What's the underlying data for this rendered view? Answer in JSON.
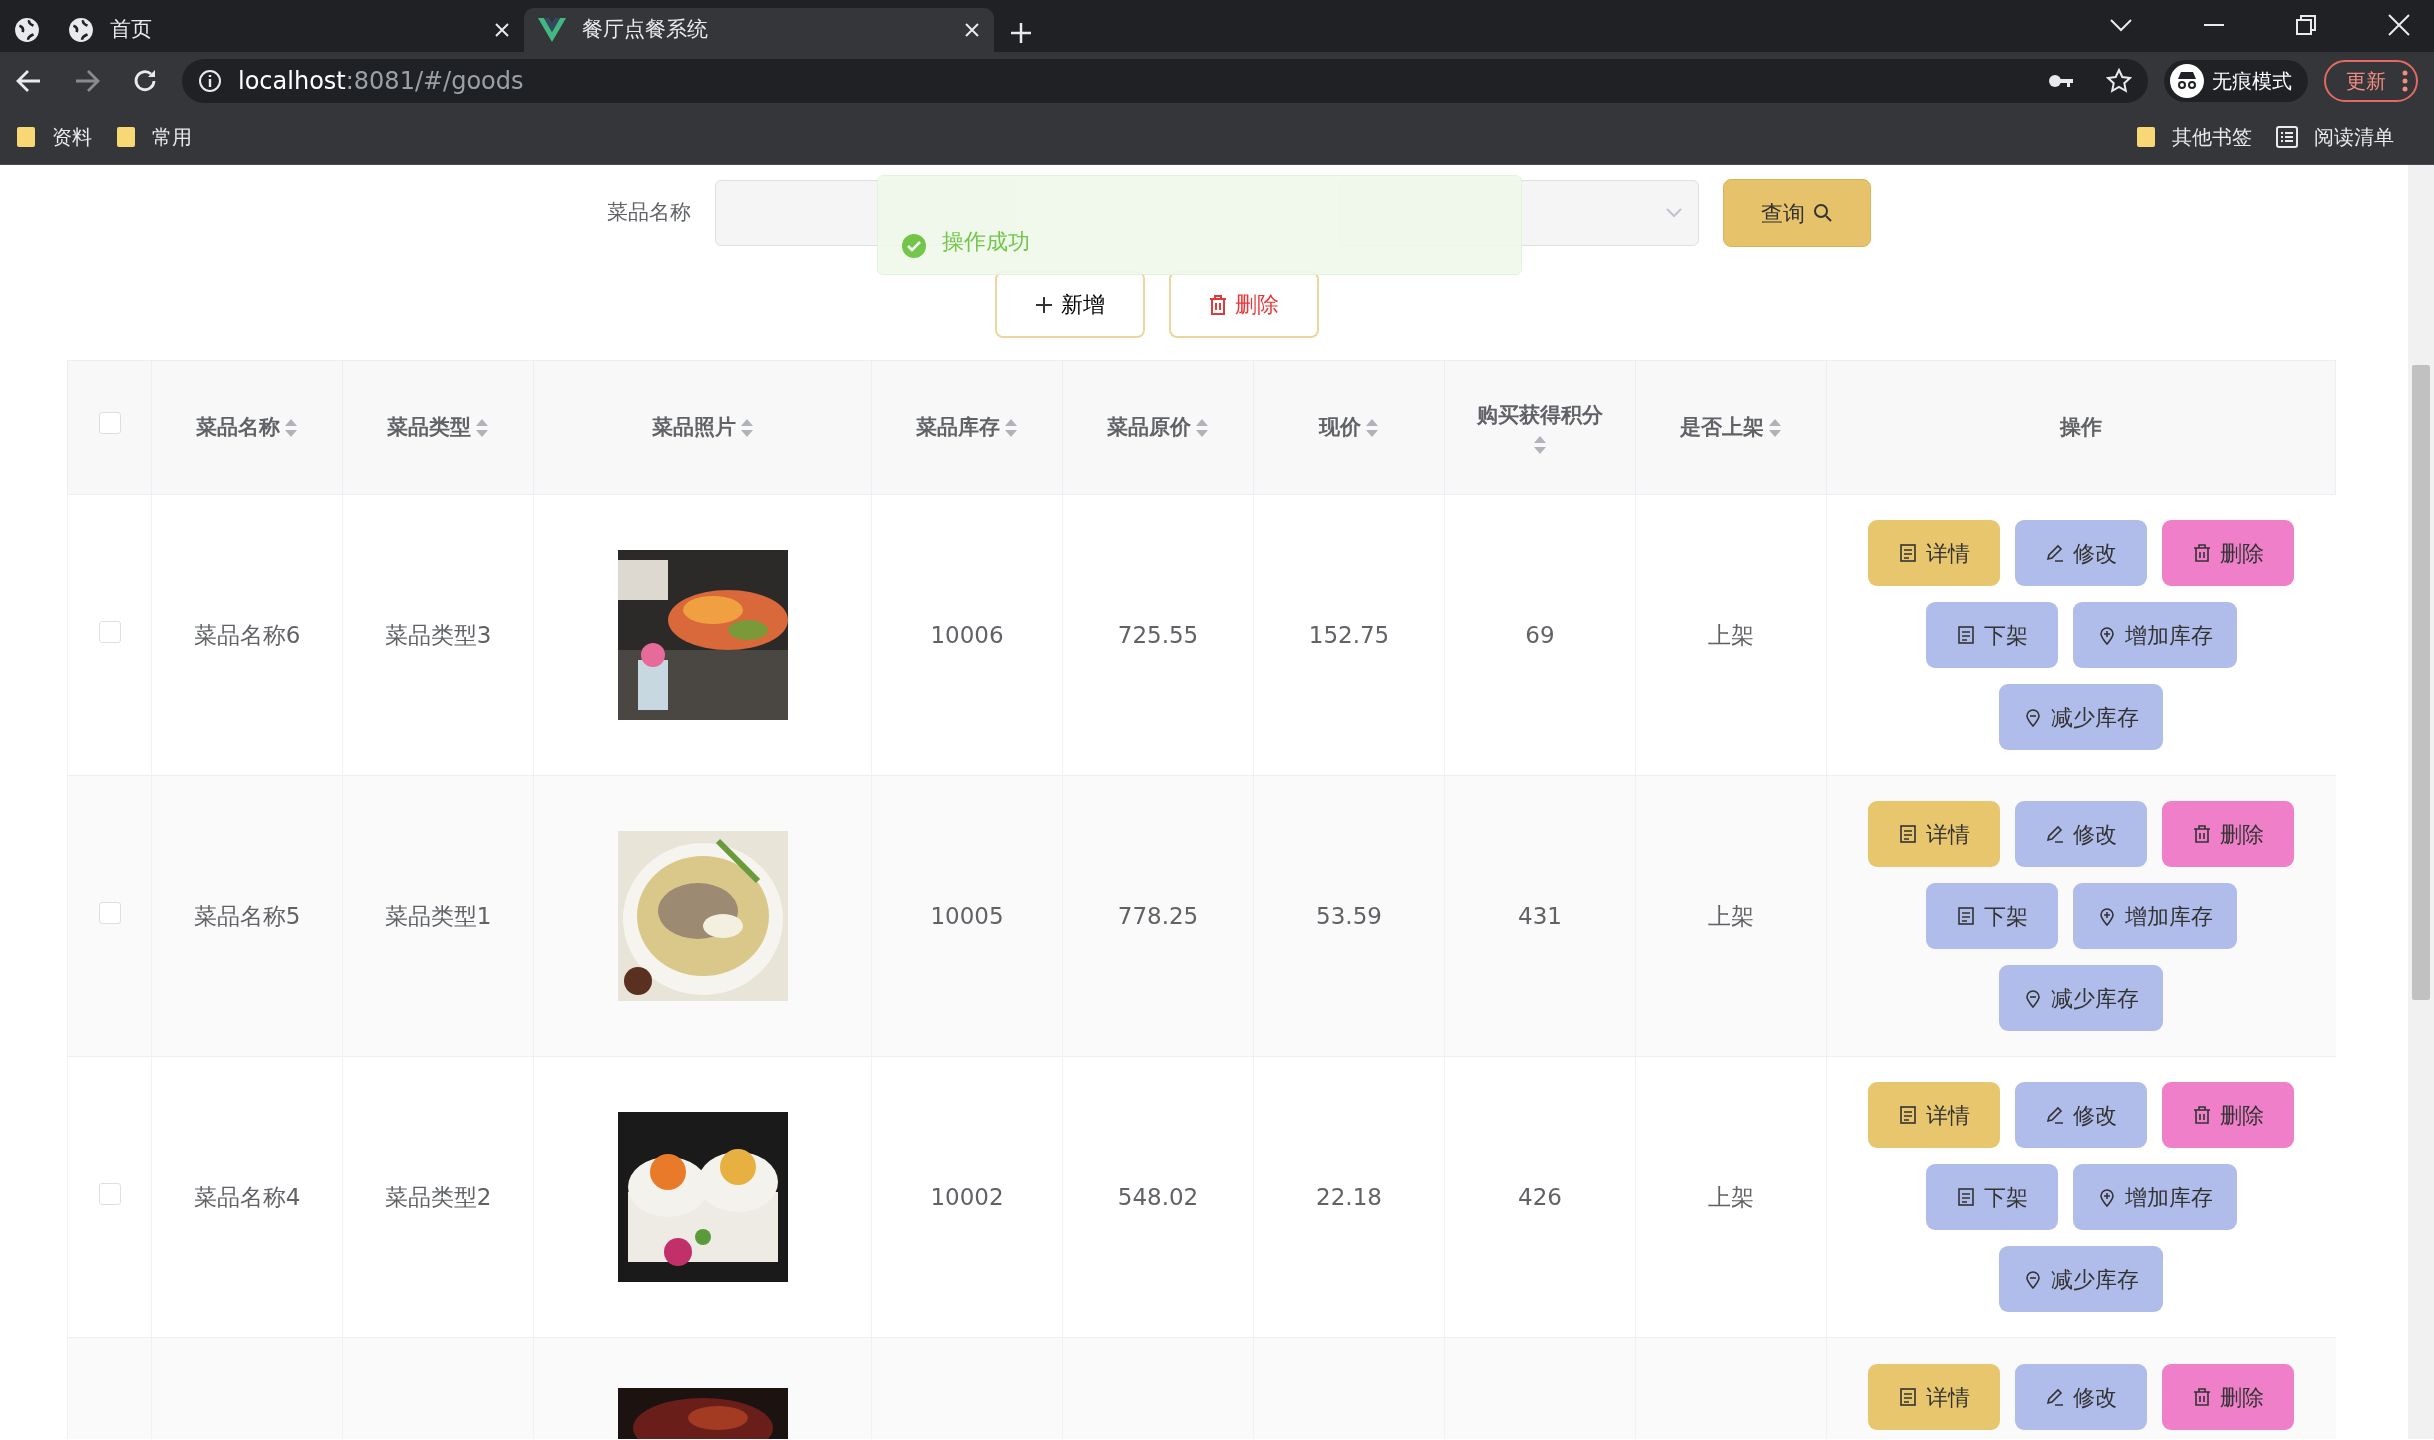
{
  "browser": {
    "tabs": [
      {
        "kind": "pinned",
        "selected": false
      },
      {
        "title": "首页",
        "kind": "page",
        "selected": false
      },
      {
        "title": "餐厅点餐系统",
        "kind": "app",
        "selected": true
      }
    ],
    "url_host": "localhost",
    "url_path": ":8081/#/goods",
    "profile": "无痕模式",
    "update_button": "更新",
    "bookmarks": [
      {
        "label": "资料",
        "kind": "folder"
      },
      {
        "label": "常用",
        "kind": "folder"
      }
    ],
    "bookmarks_right": [
      {
        "label": "其他书签",
        "kind": "folder"
      },
      {
        "label": "阅读清单",
        "kind": "list"
      }
    ]
  },
  "search": {
    "label": "菜品名称",
    "fields": [
      {
        "kind": "input"
      },
      {
        "kind": "select"
      }
    ],
    "button": "查询"
  },
  "toast": {
    "text": "操作成功",
    "kind": "success"
  },
  "toolbar": [
    {
      "label": "新增",
      "kind": "add"
    },
    {
      "label": "删除",
      "kind": "delete"
    }
  ],
  "table": {
    "select_all": {
      "checked": false
    },
    "columns": [
      {
        "label": "菜品名称",
        "kind": "text",
        "sortable": true
      },
      {
        "label": "菜品类型",
        "kind": "text",
        "sortable": true
      },
      {
        "label": "菜品照片",
        "sortable": true
      },
      {
        "label": "菜品库存",
        "kind": "text",
        "sortable": true
      },
      {
        "label": "菜品原价",
        "kind": "text",
        "sortable": true
      },
      {
        "label": "现价",
        "kind": "text",
        "sortable": true
      },
      {
        "label": "购买获得积分",
        "kind": "text",
        "sortable": true
      },
      {
        "label": "是否上架",
        "kind": "text",
        "sortable": true
      },
      {
        "label": "操作",
        "kind": "actions",
        "sortable": false
      }
    ],
    "rows": [
      {
        "checked": false,
        "cells": [
          "菜品名称6",
          "菜品类型3",
          {
            "kind": "picture"
          },
          "10006",
          "725.55",
          "152.75",
          "69",
          "上架"
        ],
        "actions": [
          {
            "label": "详情",
            "kind": "detail"
          },
          {
            "label": "修改",
            "kind": "edit"
          },
          {
            "label": "删除",
            "kind": "delete"
          },
          {
            "label": "下架",
            "kind": "unlist"
          },
          {
            "label": "增加库存",
            "kind": "stock_add"
          },
          {
            "label": "减少库存",
            "kind": "stock_remove"
          }
        ]
      },
      {
        "checked": false,
        "cells": [
          "菜品名称5",
          "菜品类型1",
          {
            "kind": "picture"
          },
          "10005",
          "778.25",
          "53.59",
          "431",
          "上架"
        ],
        "actions": [
          {
            "label": "详情",
            "kind": "detail"
          },
          {
            "label": "修改",
            "kind": "edit"
          },
          {
            "label": "删除",
            "kind": "delete"
          },
          {
            "label": "下架",
            "kind": "unlist"
          },
          {
            "label": "增加库存",
            "kind": "stock_add"
          },
          {
            "label": "减少库存",
            "kind": "stock_remove"
          }
        ]
      },
      {
        "checked": false,
        "cells": [
          "菜品名称4",
          "菜品类型2",
          {
            "kind": "picture"
          },
          "10002",
          "548.02",
          "22.18",
          "426",
          "上架"
        ],
        "actions": [
          {
            "label": "详情",
            "kind": "detail"
          },
          {
            "label": "修改",
            "kind": "edit"
          },
          {
            "label": "删除",
            "kind": "delete"
          },
          {
            "label": "下架",
            "kind": "unlist"
          },
          {
            "label": "增加库存",
            "kind": "stock_add"
          },
          {
            "label": "减少库存",
            "kind": "stock_remove"
          }
        ]
      },
      {
        "cells": [
          null,
          null,
          {
            "kind": "picture"
          }
        ],
        "actions": [
          {
            "label": "详情",
            "kind": "detail"
          },
          {
            "label": "修改",
            "kind": "edit"
          },
          {
            "label": "删除",
            "kind": "delete"
          }
        ]
      }
    ]
  }
}
